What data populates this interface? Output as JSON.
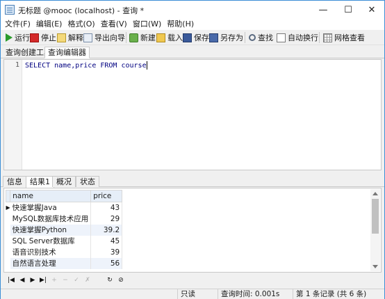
{
  "window": {
    "title": "无标题 @mooc (localhost) - 查询 *"
  },
  "window_controls": {
    "minimize": "—",
    "maximize": "☐",
    "close": "✕"
  },
  "menubar": {
    "items": [
      "文件(F)",
      "编辑(E)",
      "格式(O)",
      "查看(V)",
      "窗口(W)",
      "帮助(H)"
    ]
  },
  "toolbar": {
    "run": "运行",
    "stop": "停止",
    "explain": "解释",
    "export_wizard": "导出向导",
    "new": "新建",
    "load": "载入",
    "save": "保存",
    "save_as": "另存为",
    "find": "查找",
    "word_wrap": "自动换行",
    "grid_view": "网格查看"
  },
  "editor_tabs": [
    "查询创建工具",
    "查询编辑器"
  ],
  "editor": {
    "line_number": "1",
    "sql": "SELECT name,price FROM course"
  },
  "result_tabs": [
    "信息",
    "结果1",
    "概况",
    "状态"
  ],
  "results": {
    "columns": [
      "name",
      "price"
    ],
    "rows": [
      {
        "name": "快速掌握Java",
        "price": "43"
      },
      {
        "name": "MySQL数据库技术应用",
        "price": "29"
      },
      {
        "name": "快速掌握Python",
        "price": "39.2"
      },
      {
        "name": "SQL Server数据库",
        "price": "45"
      },
      {
        "name": "语音识别技术",
        "price": "39"
      },
      {
        "name": "自然语言处理",
        "price": "56"
      }
    ]
  },
  "navigation": {
    "first": "|◀",
    "prev": "◀",
    "next": "▶",
    "last": "▶|",
    "add": "+",
    "delete": "−",
    "confirm": "✓",
    "cancel": "✗",
    "refresh": "↻",
    "stop": "⊘"
  },
  "status": {
    "mode": "只读",
    "query_time": "查询时间: 0.001s",
    "record": "第 1 条记录 (共 6 条)"
  }
}
